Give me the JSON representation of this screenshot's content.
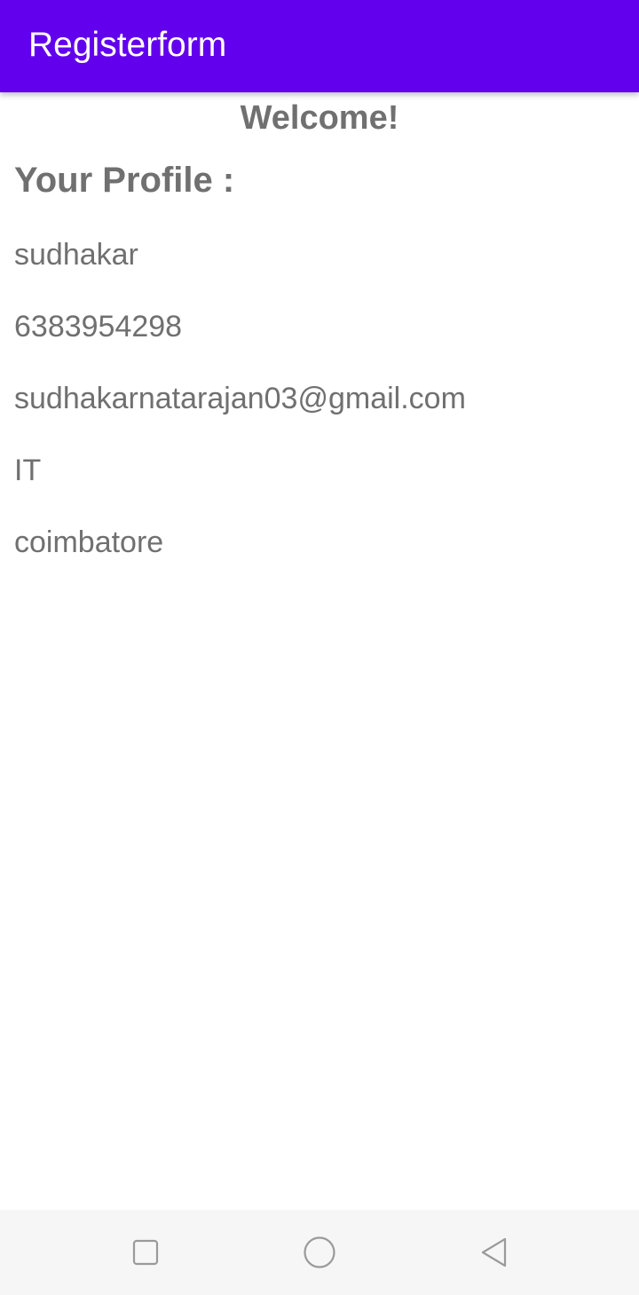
{
  "app_bar": {
    "title": "Registerform"
  },
  "content": {
    "welcome": "Welcome!",
    "profile_heading": "Your Profile :",
    "fields": {
      "name": "sudhakar",
      "phone": "6383954298",
      "email": "sudhakarnatarajan03@gmail.com",
      "department": "IT",
      "city": "coimbatore"
    }
  },
  "nav_bar": {
    "icons": [
      "recent-apps-icon",
      "home-icon",
      "back-icon"
    ]
  },
  "colors": {
    "app_bar": "#6200EE",
    "text": "#707070",
    "nav_bar_bg": "#f6f6f6"
  }
}
